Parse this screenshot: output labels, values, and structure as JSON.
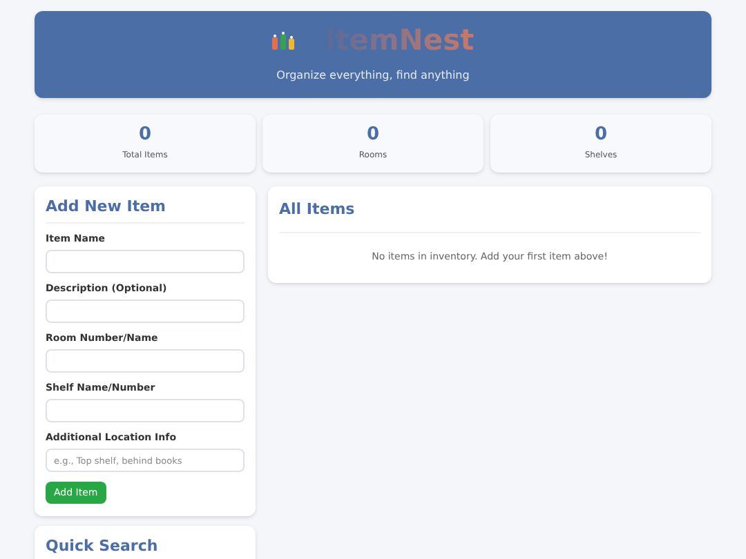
{
  "header": {
    "title": "ItemNest",
    "subtitle": "Organize everything, find anything"
  },
  "stats": [
    {
      "value": "0",
      "label": "Total Items"
    },
    {
      "value": "0",
      "label": "Rooms"
    },
    {
      "value": "0",
      "label": "Shelves"
    }
  ],
  "add_form": {
    "title": "Add New Item",
    "fields": [
      {
        "label": "Item Name"
      },
      {
        "label": "Description (Optional)"
      },
      {
        "label": "Room Number/Name"
      },
      {
        "label": "Shelf Name/Number"
      },
      {
        "label": "Additional Location Info",
        "placeholder": "e.g., Top shelf, behind books"
      }
    ],
    "button": "Add Item"
  },
  "quick_search": {
    "title": "Quick Search"
  },
  "all_items": {
    "title": "All Items",
    "empty_message": "No items in inventory. Add your first item above!"
  }
}
